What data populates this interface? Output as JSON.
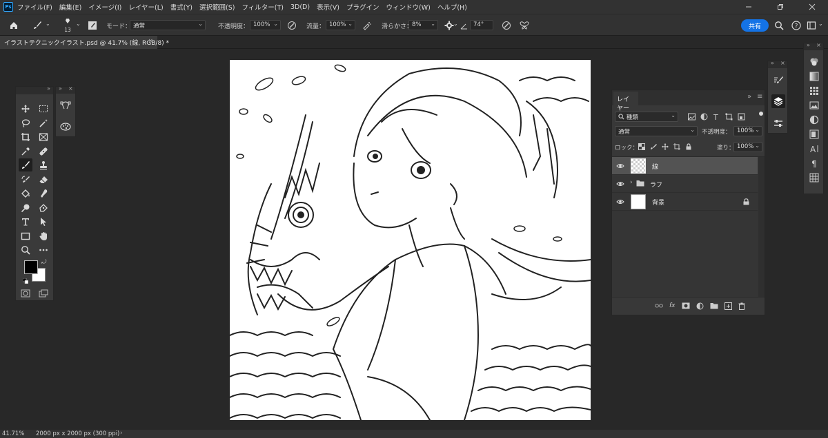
{
  "app": {
    "logo": "Ps",
    "menu": [
      "ファイル(F)",
      "編集(E)",
      "イメージ(I)",
      "レイヤー(L)",
      "書式(Y)",
      "選択範囲(S)",
      "フィルター(T)",
      "3D(D)",
      "表示(V)",
      "プラグイン",
      "ウィンドウ(W)",
      "ヘルプ(H)"
    ]
  },
  "options": {
    "brush_size": "13",
    "mode_label": "モード：",
    "mode_value": "通常",
    "opacity_label": "不透明度：",
    "opacity_value": "100%",
    "flow_label": "流量：",
    "flow_value": "100%",
    "smoothing_label": "滑らかさ：",
    "smoothing_value": "8%",
    "angle_value": "74°",
    "share_label": "共有"
  },
  "document": {
    "tab_title": "イラストテクニックイラスト.psd @ 41.7% (線, RGB/8) *",
    "close": "×"
  },
  "layers_panel": {
    "tab": "レイヤー",
    "filter_kind": "種類",
    "blend_mode": "通常",
    "opacity_label": "不透明度：",
    "opacity_value": "100%",
    "lock_label": "ロック：",
    "fill_label": "塗り：",
    "fill_value": "100%",
    "layers": [
      {
        "name": "線",
        "selected": true
      },
      {
        "name": "ラフ",
        "selected": false
      },
      {
        "name": "背景",
        "selected": false
      }
    ]
  },
  "status": {
    "zoom": "41.71%",
    "doc_size": "2000 px x 2000 px (300 ppi)"
  },
  "colors": {
    "accent": "#1473e6",
    "foreground": "#000000",
    "background": "#ffffff"
  }
}
